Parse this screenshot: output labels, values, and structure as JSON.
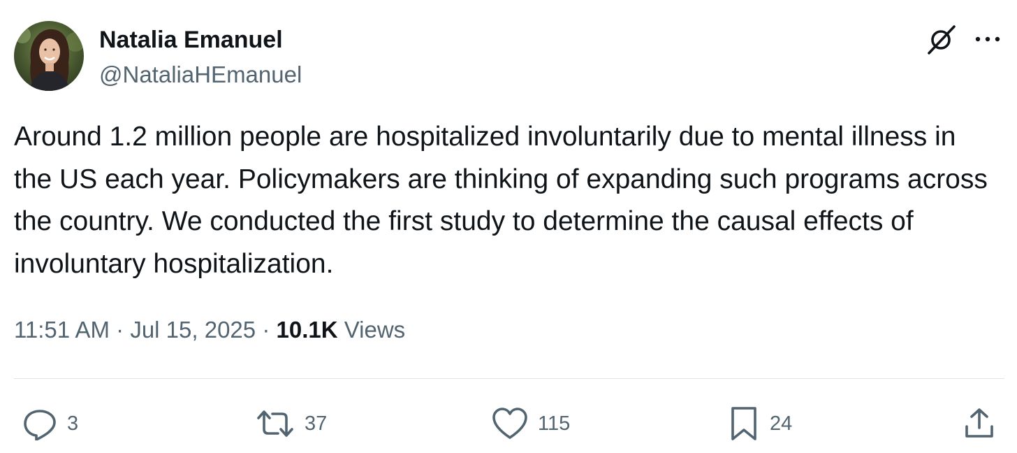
{
  "author": {
    "name": "Natalia Emanuel",
    "handle": "@NataliaHEmanuel"
  },
  "tweet": {
    "text": "Around 1.2 million people are hospitalized involuntarily due to mental illness in the US each year. Policymakers are thinking of expanding such programs across the country. We conducted the first study to determine the causal effects of involuntary hospitalization.",
    "time": "11:51 AM",
    "date": "Jul 15, 2025",
    "separator": "·",
    "views_count": "10.1K",
    "views_label": "Views"
  },
  "actions": {
    "replies": "3",
    "reposts": "37",
    "likes": "115",
    "bookmarks": "24"
  },
  "icons": {
    "grok": "grok-icon",
    "more": "more-icon",
    "reply": "reply-icon",
    "repost": "repost-icon",
    "like": "heart-icon",
    "bookmark": "bookmark-icon",
    "share": "share-icon"
  },
  "colors": {
    "text": "#0f1419",
    "secondary": "#536471",
    "divider": "#dfe3e6"
  }
}
